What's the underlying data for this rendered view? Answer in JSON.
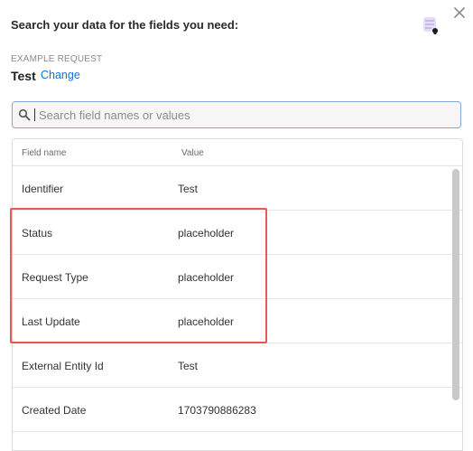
{
  "header": {
    "title": "Search your data for the fields you need:"
  },
  "request": {
    "section_label": "EXAMPLE REQUEST",
    "name": "Test",
    "change_label": "Change"
  },
  "search": {
    "placeholder": "Search field names or values",
    "value": ""
  },
  "table": {
    "columns": [
      "Field name",
      "Value"
    ],
    "rows": [
      {
        "name": "Identifier",
        "value": "Test"
      },
      {
        "name": "Status",
        "value": "placeholder"
      },
      {
        "name": "Request Type",
        "value": "placeholder"
      },
      {
        "name": "Last Update",
        "value": "placeholder"
      },
      {
        "name": "External Entity Id",
        "value": "Test"
      },
      {
        "name": "Created Date",
        "value": "1703790886283"
      }
    ]
  },
  "colors": {
    "highlight": "#e8594f",
    "link": "#1a6fd6",
    "search_border": "#7fa7d8"
  },
  "icons": {
    "close": "close-icon",
    "avatar": "avatar-icon",
    "search": "search-icon"
  }
}
